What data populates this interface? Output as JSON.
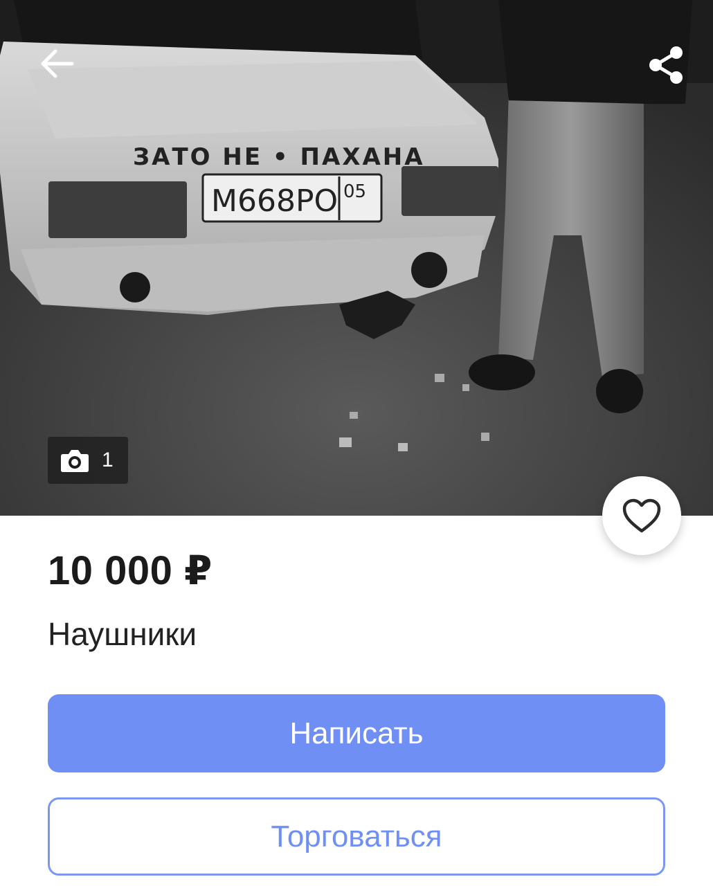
{
  "listing": {
    "photo": {
      "alt_scene": "black-and-white night photo of car rear with person standing",
      "car_text": "ЗАТО НЕ • ПАХАНА",
      "plate_main": "М668РО",
      "plate_region": "05",
      "counter": "1"
    },
    "price": "10 000 ₽",
    "title": "Наушники"
  },
  "actions": {
    "write_label": "Написать",
    "bargain_label": "Торговаться"
  },
  "icons": {
    "back": "arrow-left-icon",
    "share": "share-icon",
    "camera": "camera-icon",
    "favorite": "heart-outline-icon"
  },
  "colors": {
    "primary": "#6f8ff5",
    "primary_border": "#7b98f0",
    "text_dark": "#1b1b1b",
    "overlay": "#1e1e1e"
  }
}
